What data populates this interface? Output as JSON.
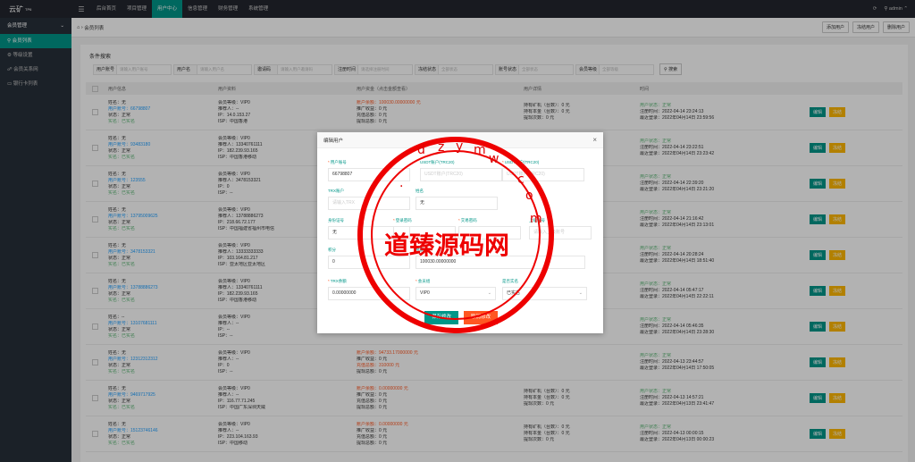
{
  "app": {
    "logo": "云矿",
    "logo_sup": "TP6",
    "user": "admin"
  },
  "nav": [
    "后台首页",
    "项目管理",
    "用户中心",
    "信息管理",
    "财务管理",
    "系统管理"
  ],
  "sidebar": {
    "group": "会员管理",
    "items": [
      "会员列表",
      "等级设置",
      "会员关系网",
      "银行卡列表"
    ]
  },
  "crumb": "会员列表",
  "actions": [
    "添加用户",
    "冻结用户",
    "删除用户"
  ],
  "panel_title": "条件搜索",
  "search": [
    {
      "label": "用户账号",
      "placeholder": "请输入用户账号"
    },
    {
      "label": "用户名",
      "placeholder": "请输入用户名"
    },
    {
      "label": "邀请码",
      "placeholder": "请输入用户邀请码"
    },
    {
      "label": "注册时间",
      "placeholder": "请选择注册时间"
    },
    {
      "label": "冻结状态",
      "placeholder": "全部状态"
    },
    {
      "label": "账号状态",
      "placeholder": "全部状态"
    },
    {
      "label": "会员等级",
      "placeholder": "全部等级"
    }
  ],
  "search_btn": "搜索",
  "columns": [
    "用户信息",
    "用户资料",
    "用户资金（点击金额查看）",
    "用户详情",
    "时间",
    ""
  ],
  "rows": [
    {
      "c1": [
        "姓名：无",
        "用户账号：66798807",
        "状态：正常",
        "实名：已实名"
      ],
      "c2": [
        "会员等级：VIP0",
        "推荐人：--",
        "IP：14.0.153.27",
        "ISP：中国香港"
      ],
      "c3": [
        "账户余额：100030.00000000 元",
        "推广收益：0 元",
        "充值总额：0 元",
        "提现总额：0 元"
      ],
      "c4": [
        "持有矿机（台数）：0 元",
        "持有本金（台数）：0 元",
        "提现次数：0 元"
      ],
      "c5": [
        "用户状态：正常",
        "注册时间：2022-04-14 23:24:13",
        "最近登录：2022年04月14日 23:59:56"
      ]
    },
    {
      "c1": [
        "姓名：无",
        "用户账号：93483180",
        "状态：正常",
        "实名：已实名"
      ],
      "c2": [
        "会员等级：VIP0",
        "推荐人：13340761111",
        "IP：182.239.93.165",
        "ISP：中国香港移动"
      ],
      "c3": [
        "",
        "",
        "",
        ""
      ],
      "c4": [
        "持有矿机（台数）：0 元",
        "持有本金（台数）：0 元",
        ""
      ],
      "c5": [
        "用户状态：正常",
        "注册时间：2022-04-14 23:22:51",
        "最近登录：2022年04月14日 23:23:42"
      ]
    },
    {
      "c1": [
        "姓名：无",
        "用户账号：123555",
        "状态：正常",
        "实名：已实名"
      ],
      "c2": [
        "会员等级：VIP0",
        "推荐人：3478153321",
        "IP：0",
        "ISP：--"
      ],
      "c3": [
        "",
        "",
        "",
        ""
      ],
      "c4": [
        "",
        "",
        ""
      ],
      "c5": [
        "用户状态：正常",
        "注册时间：2022-04-14 22:39:20",
        "最近登录：2022年04月14日 23:21:20"
      ]
    },
    {
      "c1": [
        "姓名：无",
        "用户账号：13795009625",
        "状态：正常",
        "实名：已实名"
      ],
      "c2": [
        "会员等级：VIP0",
        "推荐人：13788886273",
        "IP：218.66.72.177",
        "ISP：中国福建省福州市电信"
      ],
      "c3": [
        "",
        "",
        "",
        ""
      ],
      "c4": [
        "",
        "",
        ""
      ],
      "c5": [
        "用户状态：正常",
        "注册时间：2022-04-14 21:16:42",
        "最近登录：2022年04月14日 23:13:01"
      ]
    },
    {
      "c1": [
        "姓名：无",
        "用户账号：3478153321",
        "状态：正常",
        "实名：已实名"
      ],
      "c2": [
        "会员等级：VIP0",
        "推荐人：13333333333",
        "IP：103.164.81.217",
        "ISP：亚太地区亚太地区"
      ],
      "c3": [
        "",
        "",
        "",
        ""
      ],
      "c4": [
        "",
        "",
        ""
      ],
      "c5": [
        "用户状态：正常",
        "注册时间：2022-04-14 20:28:24",
        "最近登录：2022年04月14日 18:51:40"
      ]
    },
    {
      "c1": [
        "姓名：无",
        "用户账号：13788886273",
        "状态：正常",
        "实名：已实名"
      ],
      "c2": [
        "会员等级：VIP0",
        "推荐人：13340761111",
        "IP：182.239.93.165",
        "ISP：中国香港移动"
      ],
      "c3": [
        "",
        "",
        "",
        ""
      ],
      "c4": [
        "",
        "",
        ""
      ],
      "c5": [
        "用户状态：正常",
        "注册时间：2022-04-14 05:47:17",
        "最近登录：2022年04月14日 22:22:11"
      ]
    },
    {
      "c1": [
        "姓名：--",
        "用户账号：13107681111",
        "状态：正常",
        "实名：已实名"
      ],
      "c2": [
        "会员等级：VIP0",
        "推荐人：--",
        "IP：--",
        "ISP：--"
      ],
      "c3": [
        "",
        "",
        "",
        "提现总额：0 元"
      ],
      "c4": [
        "",
        "",
        "提现次数：0 元"
      ],
      "c5": [
        "用户状态：正常",
        "注册时间：2022-04-14 05:46:35",
        "最近登录：2022年04月14日 23:28:30"
      ]
    },
    {
      "c1": [
        "姓名：无",
        "用户账号：12312312312",
        "状态：正常",
        "实名：已实名"
      ],
      "c2": [
        "会员等级：VIP0",
        "推荐人：--",
        "IP：0",
        "ISP：--"
      ],
      "c3": [
        "账户余额：94733.17000000 元",
        "推广收益：0 元",
        "充值总额：310000 元",
        "提现总额：0 元"
      ],
      "c4": [
        "",
        "",
        ""
      ],
      "c5": [
        "用户状态：正常",
        "注册时间：2022-04-13 23:44:57",
        "最近登录：2022年04月14日 17:50:05"
      ]
    },
    {
      "c1": [
        "姓名：无",
        "用户账号：9469717925",
        "状态：正常",
        "实名：已实名"
      ],
      "c2": [
        "会员等级：VIP0",
        "推荐人：--",
        "IP：116.77.71.245",
        "ISP：中国广东深圳天威"
      ],
      "c3": [
        "账户余额：0.00000000 元",
        "推广收益：0 元",
        "充值总额：0 元",
        "提现总额：0 元"
      ],
      "c4": [
        "持有矿机（台数）：0 元",
        "持有本金（台数）：0 元",
        "提现次数：0 元"
      ],
      "c5": [
        "用户状态：正常",
        "注册时间：2022-04-13 14:57:21",
        "最近登录：2022年04月13日 23:41:47"
      ]
    },
    {
      "c1": [
        "姓名：无",
        "用户账号：15123746146",
        "状态：正常",
        "实名：已实名"
      ],
      "c2": [
        "会员等级：VIP0",
        "推荐人：--",
        "IP：223.104.163.93",
        "ISP：中国移动"
      ],
      "c3": [
        "账户余额：0.00000000 元",
        "推广收益：0 元",
        "充值总额：0 元",
        "提现总额：0 元"
      ],
      "c4": [
        "持有矿机（台数）：0 元",
        "持有本金（台数）：0 元",
        "提现次数：0 元"
      ],
      "c5": [
        "用户状态：正常",
        "注册时间：2022-04-13 00:00:15",
        "最近登录：2022年04月13日 00:00:23"
      ]
    }
  ],
  "row_actions": {
    "edit": "编辑",
    "del": "冻结"
  },
  "modal": {
    "title": "编辑用户",
    "fields": [
      {
        "label": "用户账号",
        "value": "66798807",
        "req": true
      },
      {
        "label": "USDT账户(TRC20)",
        "value": "",
        "placeholder": "USDT账户(TRC20)",
        "req": false
      },
      {
        "label": "USDT账户(TRC20)",
        "value": "",
        "placeholder": "USDT账户(TRC20)",
        "req": true
      },
      {
        "label": "TRX账户",
        "value": "",
        "placeholder": "请输入TRX",
        "req": false
      },
      {
        "label": "姓名",
        "value": "无",
        "req": false
      },
      {
        "label": "身份证号",
        "value": "无",
        "req": false
      },
      {
        "label": "登录密码",
        "value": "",
        "req": true
      },
      {
        "label": "交易密码",
        "value": "",
        "req": true
      },
      {
        "label": "上级账号",
        "value": "",
        "placeholder": "请输入上级账号",
        "req": false
      },
      {
        "label": "积分",
        "value": "0",
        "req": false
      },
      {
        "label": "余额",
        "value": "100030.00000000",
        "req": false
      },
      {
        "label": "TRX余额",
        "value": "0.00000000",
        "req": true
      },
      {
        "label": "会员组",
        "value": "VIP0",
        "req": true
      },
      {
        "label": "是否实名",
        "value": "已实名",
        "req": false
      }
    ],
    "save": "保存修改",
    "cancel": "取消修改"
  },
  "watermark": {
    "text": "道臻源码网",
    "letters": [
      "d",
      "z",
      "y",
      "m",
      "w",
      ".",
      "c",
      "o",
      "m"
    ]
  }
}
